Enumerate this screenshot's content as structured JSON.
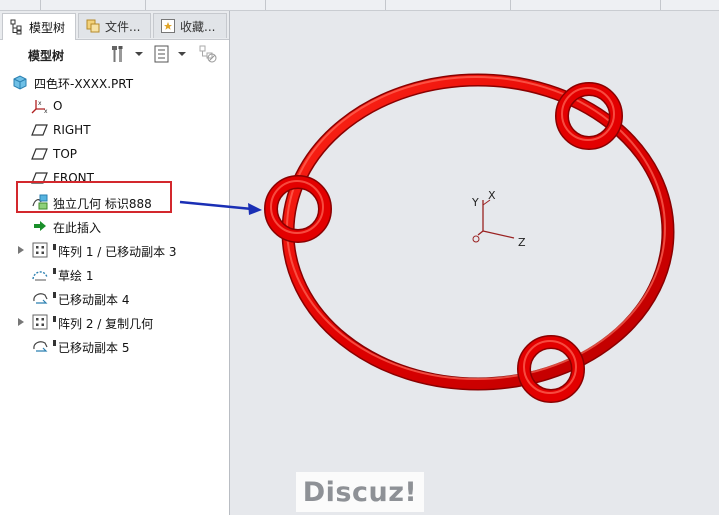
{
  "tabs": [
    {
      "label": "模型树",
      "icon": "tree-icon"
    },
    {
      "label": "文件...",
      "icon": "folder-icon"
    },
    {
      "label": "收藏...",
      "icon": "favorites-icon"
    }
  ],
  "toolbar": {
    "title": "模型树",
    "settings_icon": "tools-icon",
    "show_icon": "list-icon",
    "filter_icon": "filter-icon"
  },
  "tree": {
    "root": "四色环-XXXX.PRT",
    "items": [
      {
        "label": "O",
        "icon": "csys-icon"
      },
      {
        "label": "RIGHT",
        "icon": "datum-plane-icon"
      },
      {
        "label": "TOP",
        "icon": "datum-plane-icon"
      },
      {
        "label": "FRONT",
        "icon": "datum-plane-icon"
      },
      {
        "label": "独立几何 标识888",
        "icon": "independent-geometry-icon"
      },
      {
        "label": "在此插入",
        "icon": "insert-arrow-icon"
      },
      {
        "label": "阵列 1 / 已移动副本 3",
        "icon": "pattern-icon",
        "expandable": true
      },
      {
        "label": "草绘 1",
        "icon": "sketch-icon"
      },
      {
        "label": "已移动副本 4",
        "icon": "moved-copy-icon"
      },
      {
        "label": "阵列 2 / 复制几何",
        "icon": "pattern-icon",
        "expandable": true
      },
      {
        "label": "已移动副本 5",
        "icon": "moved-copy-icon"
      }
    ]
  },
  "viewport": {
    "axis_labels": {
      "x": "X",
      "y": "Y",
      "z": "Z"
    },
    "ring_color": "#e50000",
    "watermark": "Discuz!"
  },
  "colors": {
    "highlight": "#d3282d",
    "arrow": "#1a2fb5",
    "axis": "#9a2222"
  }
}
